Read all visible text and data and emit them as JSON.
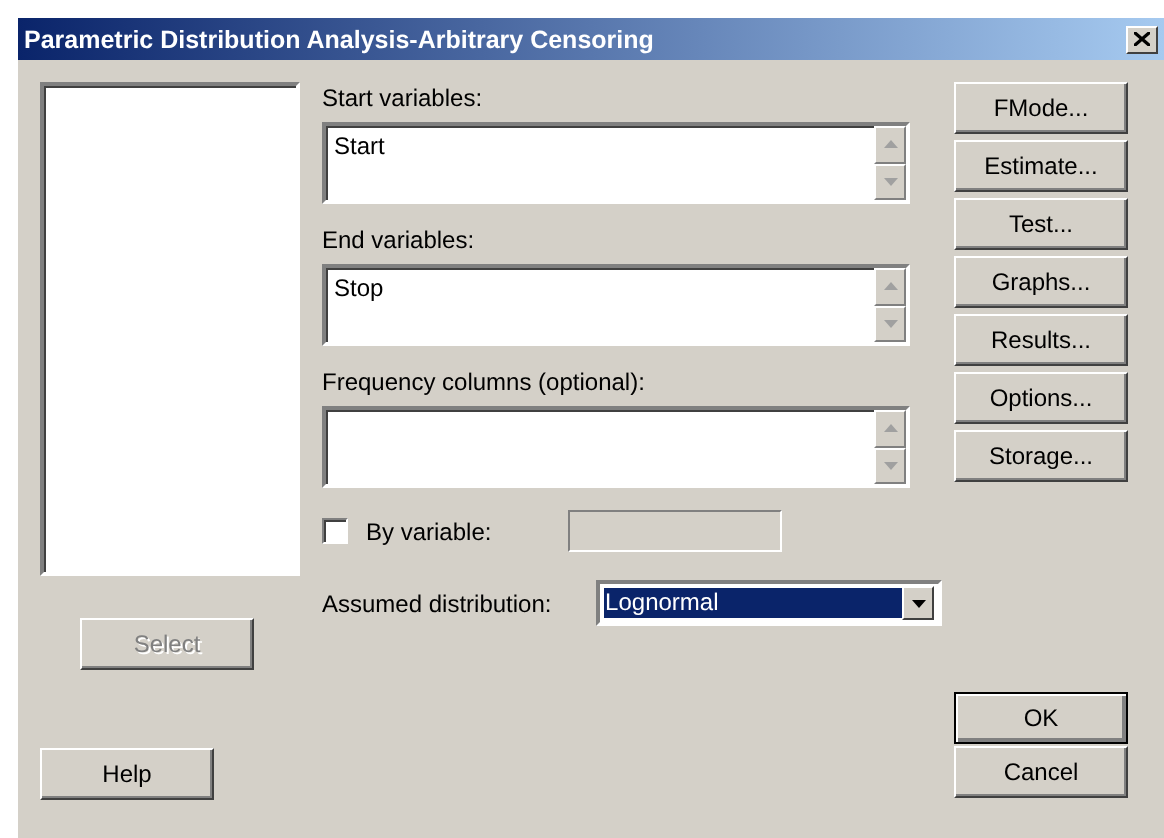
{
  "window": {
    "title": "Parametric Distribution Analysis-Arbitrary Censoring"
  },
  "select_button": {
    "label": "Select",
    "disabled": true
  },
  "help_button": {
    "label": "Help"
  },
  "fields": [
    {
      "label": "Start variables:",
      "value": "Start"
    },
    {
      "label": "End variables:",
      "value": "Stop"
    },
    {
      "label": "Frequency columns (optional):"
    }
  ],
  "by_variable": {
    "label": "By variable:",
    "checked": false
  },
  "distribution": {
    "label": "Assumed distribution:",
    "value": "Lognormal",
    "focused": true
  },
  "side_buttons": [
    "FMode...",
    "Estimate...",
    "Test...",
    "Graphs...",
    "Results...",
    "Options...",
    "Storage..."
  ],
  "ok_button": {
    "label": "OK",
    "default": true
  },
  "cancel_button": {
    "label": "Cancel"
  }
}
